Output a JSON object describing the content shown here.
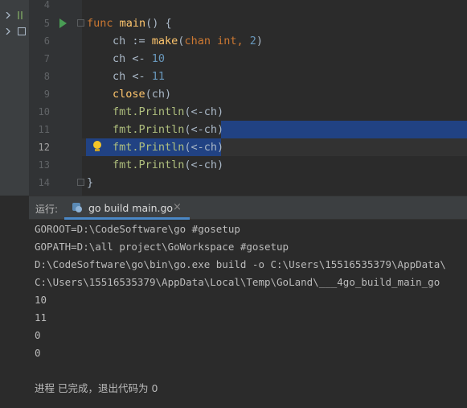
{
  "editor": {
    "lines": [
      {
        "num": "4"
      },
      {
        "num": "5"
      },
      {
        "num": "6"
      },
      {
        "num": "7"
      },
      {
        "num": "8"
      },
      {
        "num": "9"
      },
      {
        "num": "10"
      },
      {
        "num": "11"
      },
      {
        "num": "12"
      },
      {
        "num": "13"
      },
      {
        "num": "14"
      }
    ],
    "code": {
      "l5_kw": "func",
      "l5_fn": "main",
      "l5_rest": "() {",
      "l6_a": "ch := ",
      "l6_make": "make",
      "l6_b": "(",
      "l6_chan": "chan",
      "l6_sp": " ",
      "l6_int": "int",
      "l6_c": ", ",
      "l6_num": "2",
      "l6_d": ")",
      "l7_a": "ch <- ",
      "l7_num": "10",
      "l8_a": "ch <- ",
      "l8_num": "11",
      "l9_close": "close",
      "l9_b": "(ch)",
      "println_pkg": "fmt.",
      "println_fn": "Println",
      "println_arg": "(<-ch)",
      "l14": "}"
    },
    "selection_color": "#214283"
  },
  "run_window": {
    "label": "运行:",
    "tab": {
      "label": "go build main.go",
      "close": "×"
    },
    "console": [
      "GOROOT=D:\\CodeSoftware\\go #gosetup",
      "GOPATH=D:\\all project\\GoWorkspace #gosetup",
      "D:\\CodeSoftware\\go\\bin\\go.exe build -o C:\\Users\\15516535379\\AppData\\",
      "C:\\Users\\15516535379\\AppData\\Local\\Temp\\GoLand\\___4go_build_main_go",
      "10",
      "11",
      "0",
      "0",
      "",
      "进程 已完成，退出代码为 0"
    ]
  },
  "icons": {
    "run": "run-gutter-icon",
    "bulb": "intention-bulb-icon",
    "go_file": "go-file-icon"
  }
}
